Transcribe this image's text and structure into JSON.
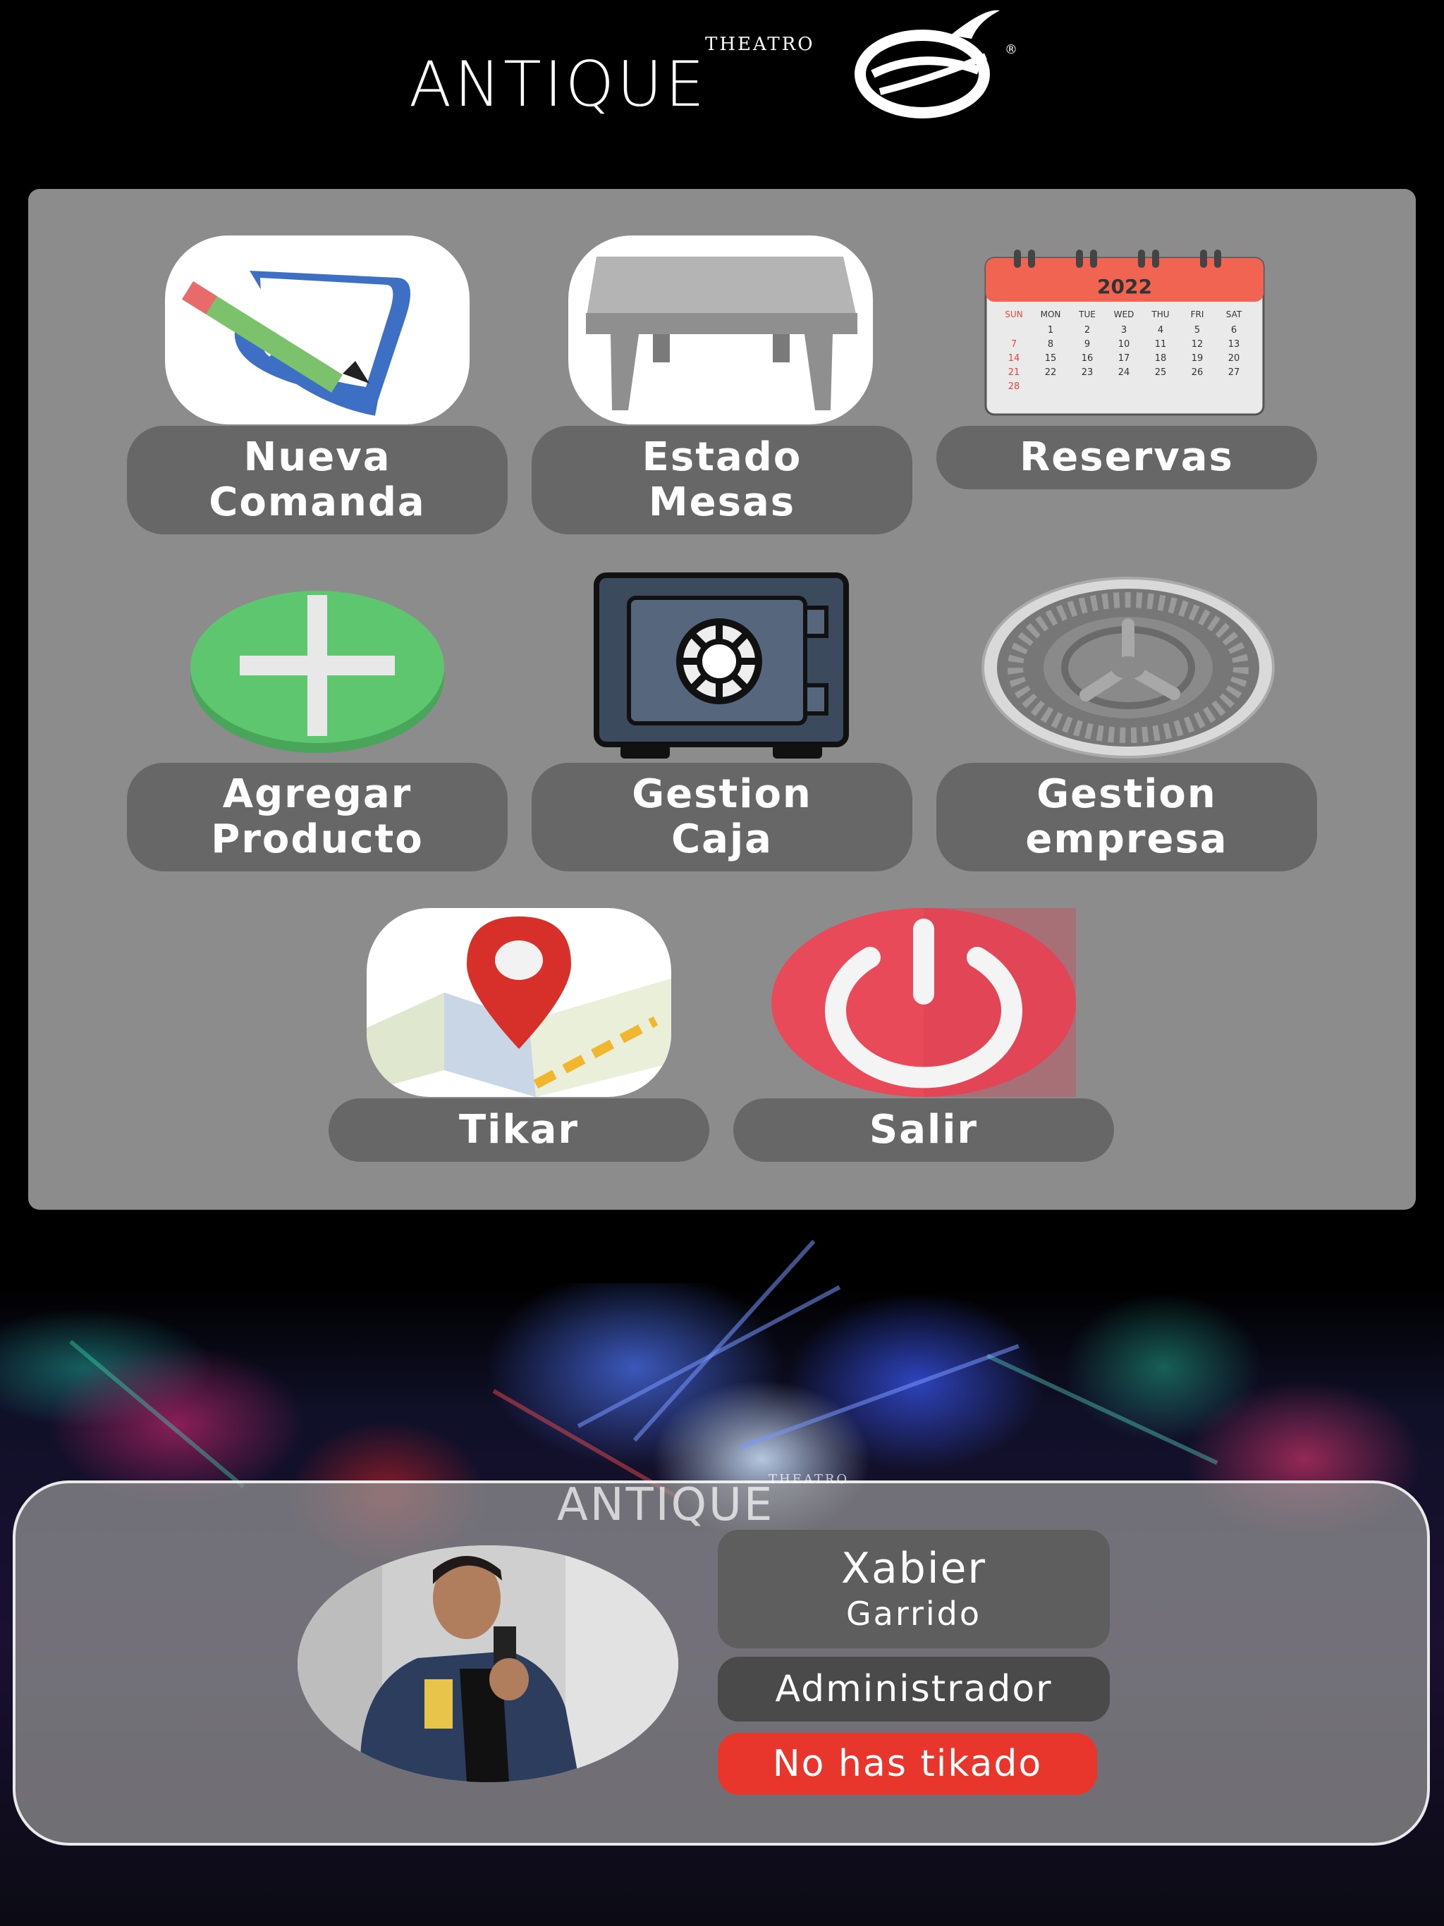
{
  "header": {
    "logo_theatro": "THEATRO",
    "logo_antique": "ANTIQUE",
    "logo_reg": "®"
  },
  "menu": {
    "nueva_comanda": "Nueva\nComanda",
    "estado_mesas": "Estado\nMesas",
    "reservas": "Reservas",
    "agregar_producto": "Agregar\nProducto",
    "gestion_caja": "Gestion\nCaja",
    "gestion_empresa": "Gestion\nempresa",
    "tikar": "Tikar",
    "salir": "Salir"
  },
  "calendar": {
    "year": "2022",
    "days": [
      "SUN",
      "MON",
      "TUE",
      "WED",
      "THU",
      "FRI",
      "SAT"
    ],
    "rows": [
      [
        "",
        "1",
        "2",
        "3",
        "4",
        "5",
        "6"
      ],
      [
        "7",
        "8",
        "9",
        "10",
        "11",
        "12",
        "13"
      ],
      [
        "14",
        "15",
        "16",
        "17",
        "18",
        "19",
        "20"
      ],
      [
        "21",
        "22",
        "23",
        "24",
        "25",
        "26",
        "27"
      ],
      [
        "28",
        "",
        "",
        "",
        "",
        "",
        ""
      ]
    ]
  },
  "user": {
    "first_name": "Xabier",
    "last_name": "Garrido",
    "role": "Administrador",
    "status": "No has tikado"
  },
  "colors": {
    "panel": "#8c8c8c",
    "pill": "#676767",
    "status_red": "#e8362c",
    "plus_green": "#5dc66f",
    "power_red": "#e84a5a"
  }
}
